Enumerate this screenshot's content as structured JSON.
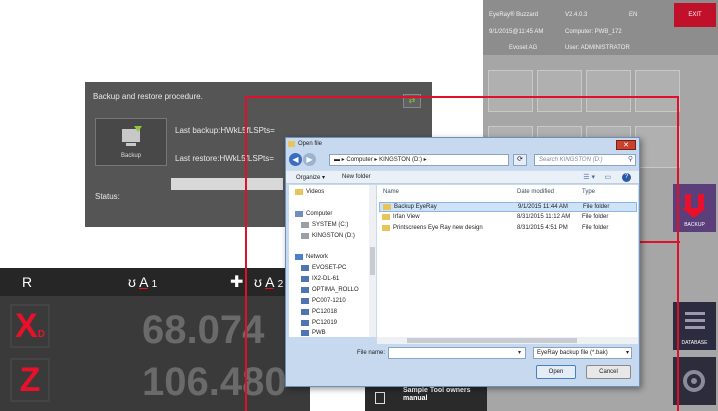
{
  "eyeray": {
    "app_name": "EyeRay® Buzzard",
    "version": "V2.4.0.3",
    "language": "EN",
    "exit_label": "EXIT",
    "datetime": "9/1/2015@11:45 AM",
    "computer": "Computer: PWB_172",
    "company": "Evoset AG",
    "user": "User: ADMINISTRATOR",
    "backup_label": "BACKUP",
    "database_label": "DATABASE",
    "accent_red": "#c0102a",
    "backup_tile_color": "#5a3f7a"
  },
  "backup_dialog": {
    "title": "Backup and restore procedure.",
    "backup_button": "Backup",
    "last_backup": "Last backup:HWkL5fLSPts=",
    "last_restore": "Last restore:HWkL5fLSPts=",
    "status_label": "Status:"
  },
  "dro": {
    "r_label": "R",
    "a1_prefix": "ʊ",
    "a1_label": "A",
    "a1_sub": "1",
    "plus": "✚",
    "a2_prefix": "ʊ",
    "a2_label": "A",
    "a2_tail": "2",
    "x_axis": "X",
    "x_sub": "D",
    "x_value": "68.074",
    "z_axis": "Z",
    "z_value": "106.480"
  },
  "sample_tile": {
    "label": "Sample Tool owners manual"
  },
  "open_file": {
    "title": "Open file",
    "close_glyph": "✕",
    "path": [
      "Computer",
      "KINGSTON (D:)"
    ],
    "search_placeholder": "Search KINGSTON (D:)",
    "organize_label": "Organize ▾",
    "new_folder_label": "New folder",
    "columns": {
      "name": "Name",
      "date": "Date modified",
      "type": "Type"
    },
    "nav": {
      "videos": "Videos",
      "computer": "Computer",
      "system": "SYSTEM (C:)",
      "kingston": "KINGSTON (D:)",
      "network": "Network",
      "pcs": [
        "EVOSET-PC",
        "IX2-DL-61",
        "OPTIMA_ROLLO",
        "PC007-1210",
        "PC12018",
        "PC12019",
        "PWB"
      ]
    },
    "files": [
      {
        "name": "Backup EyeRay",
        "date": "9/1/2015 11:44 AM",
        "type": "File folder"
      },
      {
        "name": "Irfan View",
        "date": "8/31/2015 11:12 AM",
        "type": "File folder"
      },
      {
        "name": "Printscreens Eye Ray new design",
        "date": "8/31/2015 4:51 PM",
        "type": "File folder"
      }
    ],
    "filename_label": "File name:",
    "filename_value": "",
    "filetype": "EyeRay backup file (*.bak)",
    "open_button": "Open",
    "cancel_button": "Cancel"
  }
}
